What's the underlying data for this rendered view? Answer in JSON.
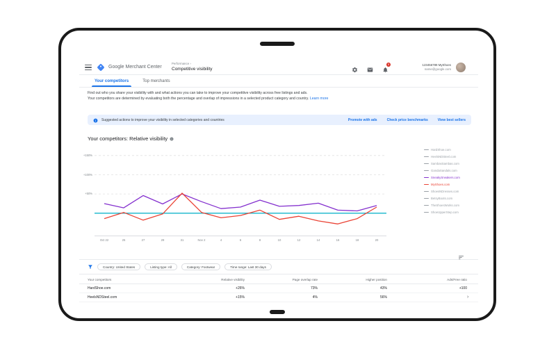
{
  "header": {
    "app_name": "Google Merchant Center",
    "breadcrumb": "Performance ›",
    "page_title": "Competitive visibility",
    "account_name": "123456789 MyShoes",
    "account_email": "name@google.com",
    "notification_count": "5"
  },
  "tabs": [
    {
      "label": "Your competitors",
      "active": true
    },
    {
      "label": "Top merchants",
      "active": false
    }
  ],
  "intro": {
    "line1": "Find out who you share your visibility with and what actions you can take to improve your competitive visibility across free listings and ads.",
    "line2": "Your competitors are determined by evaluating both the percentage and overlap of impressions in a selected product category and country.",
    "learn_more": "Learn more"
  },
  "banner": {
    "text": "Suggested actions to improve your visibility in selected categories and countries",
    "links": [
      "Promote with ads",
      "Check price benchmarks",
      "View best sellers"
    ]
  },
  "chart_data": {
    "type": "line",
    "title": "Your competitors: Relative visibility",
    "x": [
      "Oct 22",
      "25",
      "27",
      "29",
      "31",
      "Nov 2",
      "4",
      "6",
      "8",
      "10",
      "12",
      "14",
      "16",
      "18",
      "20"
    ],
    "ylim": [
      -60,
      175
    ],
    "yticks": [
      {
        "value": 150,
        "label": "+150%"
      },
      {
        "value": 100,
        "label": "+100%"
      },
      {
        "value": 50,
        "label": "+50%"
      }
    ],
    "baseline": {
      "value": 0,
      "color": "#12b5cb"
    },
    "grid": "dashed",
    "legend_position": "right",
    "series": [
      {
        "name": "SneakySneakers.com",
        "color": "#8430ce",
        "values": [
          25,
          14,
          46,
          24,
          50,
          30,
          12,
          16,
          34,
          18,
          20,
          26,
          8,
          6,
          20
        ]
      },
      {
        "name": "MyShoes.com",
        "color": "#ea4335",
        "values": [
          -14,
          2,
          -18,
          -2,
          52,
          2,
          -12,
          -6,
          8,
          -16,
          -8,
          -20,
          -28,
          -14,
          16
        ]
      }
    ],
    "legend": [
      {
        "name": "HardShoe.com",
        "color": "#9aa0a6"
      },
      {
        "name": "HeelsNDSteel.com",
        "color": "#9aa0a6"
      },
      {
        "name": "SambasSambas.com",
        "color": "#9aa0a6"
      },
      {
        "name": "GandaSandals.com",
        "color": "#9aa0a6"
      },
      {
        "name": "SneakySneakers.com",
        "color": "#8430ce"
      },
      {
        "name": "MyShoes.com",
        "color": "#ea4335"
      },
      {
        "name": "ShoesNDresses.com",
        "color": "#9aa0a6"
      },
      {
        "name": "BetsyBoots.com",
        "color": "#9aa0a6"
      },
      {
        "name": "TheShoesWorks.com",
        "color": "#9aa0a6"
      },
      {
        "name": "ShoeUpperStep.com",
        "color": "#9aa0a6"
      }
    ]
  },
  "filters": {
    "chips": [
      "Country: United States",
      "Listing type: All",
      "Category: Footwear",
      "Time range: Last 30 days"
    ]
  },
  "table": {
    "headers": [
      "Your competitors",
      "Relative visibility",
      "Page overlap rate",
      "Higher position",
      "Ads/Free ratio"
    ],
    "rows": [
      [
        "HardShoe.com",
        "+26%",
        "73%",
        "43%",
        "+100"
      ],
      [
        "HeelsNDSteel.com",
        "+15%",
        "4%",
        "56%",
        ""
      ]
    ]
  },
  "colors": {
    "accent": "#1a73e8",
    "banner_bg": "#e8f0fe",
    "baseline": "#12b5cb",
    "series_purple": "#8430ce",
    "series_red": "#ea4335",
    "badge_red": "#d93025"
  }
}
